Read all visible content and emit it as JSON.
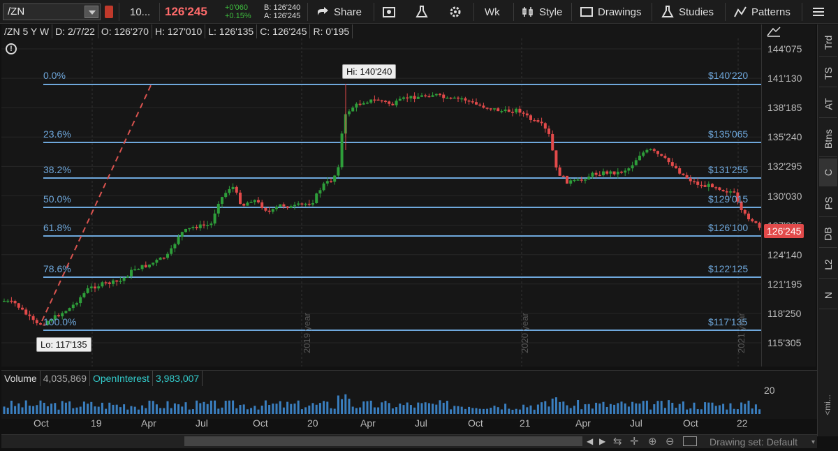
{
  "toolbar": {
    "symbol": "/ZN",
    "qty": "10...",
    "last": "126'245",
    "net_change": "+0'060",
    "net_pct": "+0.15%",
    "bid": "B: 126'240",
    "ask": "A: 126'245",
    "share": "Share",
    "timeframe": "Wk",
    "style": "Style",
    "drawings": "Drawings",
    "studies": "Studies",
    "patterns": "Patterns"
  },
  "infobar": {
    "title": "/ZN 5 Y W",
    "date": "D: 2/7/22",
    "open": "O: 126'270",
    "high": "H: 127'010",
    "low": "L: 126'135",
    "close": "C: 126'245",
    "range": "R: 0'195"
  },
  "yaxis": [
    "144'075",
    "141'130",
    "138'185",
    "135'240",
    "132'295",
    "130'030",
    "127'085",
    "124'140",
    "121'195",
    "118'250",
    "115'305"
  ],
  "fib": [
    {
      "pct": "0.0%",
      "price": "$140'220"
    },
    {
      "pct": "23.6%",
      "price": "$135'065"
    },
    {
      "pct": "38.2%",
      "price": "$131'255"
    },
    {
      "pct": "50.0%",
      "price": "$129'015"
    },
    {
      "pct": "61.8%",
      "price": "$126'100"
    },
    {
      "pct": "78.6%",
      "price": "$122'125"
    },
    {
      "pct": "100.0%",
      "price": "$117'135"
    }
  ],
  "callouts": {
    "hi": "Hi: 140'240",
    "lo": "Lo: 117'135"
  },
  "price_badge": "126'245",
  "year_markers": [
    "2019 year",
    "2020 year",
    "2021 year"
  ],
  "volume": {
    "label": "Volume",
    "value": "4,035,869",
    "oi_label": "OpenInterest",
    "oi_value": "3,983,007",
    "scale": "20"
  },
  "xaxis": [
    "Oct",
    "19",
    "Apr",
    "Jul",
    "Oct",
    "20",
    "Apr",
    "Jul",
    "Oct",
    "21",
    "Apr",
    "Jul",
    "Oct",
    "22"
  ],
  "right_panel": [
    "Trd",
    "TS",
    "AT",
    "Btns",
    "C",
    "PS",
    "DB",
    "L2",
    "N"
  ],
  "scroll": {
    "drawing_set": "Drawing set: Default"
  },
  "colors": {
    "up": "#2e9e3a",
    "down": "#e24a4a",
    "fib": "#6fa8dc",
    "dash": "#d9534f"
  }
}
